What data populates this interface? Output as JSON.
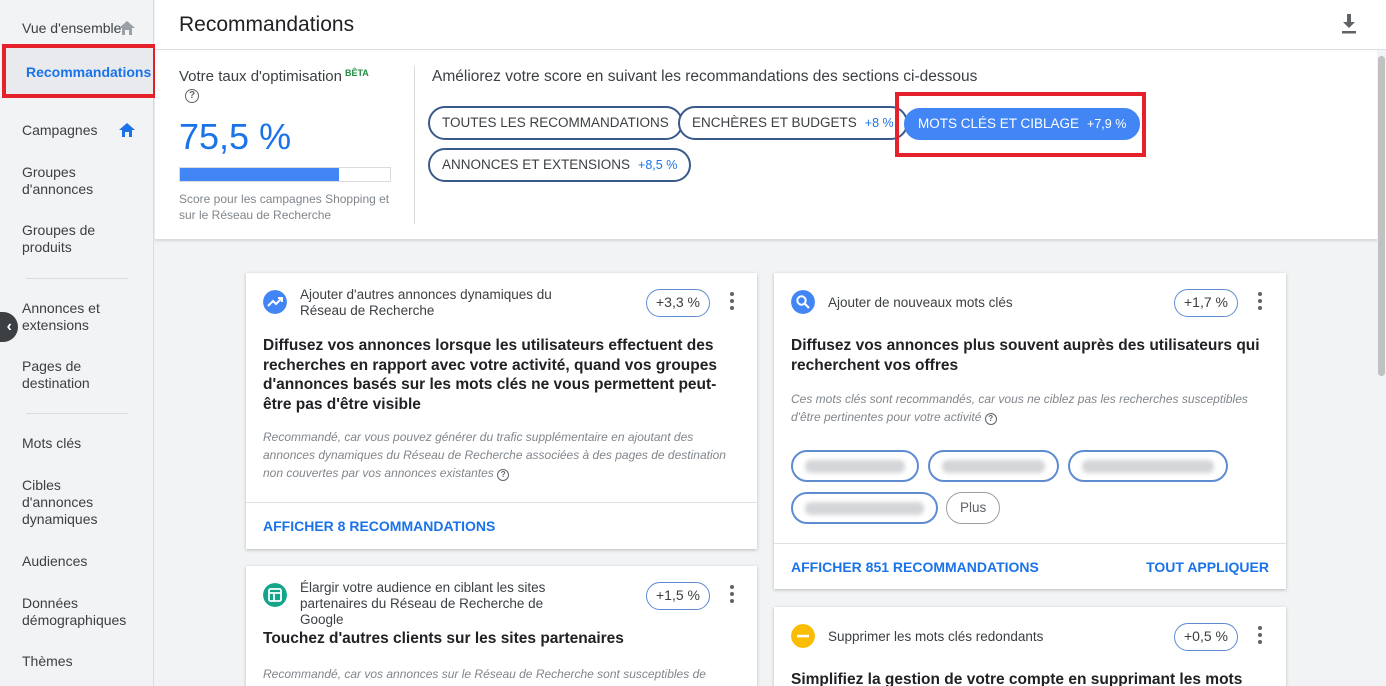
{
  "sidebar": {
    "items": [
      {
        "label": "Vue d'ensemble"
      },
      {
        "label": "Recommandations"
      },
      {
        "label": "Campagnes"
      },
      {
        "label": "Groupes d'annonces"
      },
      {
        "label": "Groupes de produits"
      },
      {
        "label": "Annonces et extensions"
      },
      {
        "label": "Pages de destination"
      },
      {
        "label": "Mots clés"
      },
      {
        "label": "Cibles d'annonces dynamiques"
      },
      {
        "label": "Audiences"
      },
      {
        "label": "Données démographiques"
      },
      {
        "label": "Thèmes"
      }
    ],
    "active": "Recommandations"
  },
  "header": {
    "title": "Recommandations",
    "download_icon": "download-icon"
  },
  "score": {
    "label": "Votre taux d'optimisation",
    "beta": "BÊTA",
    "help": "?",
    "value": "75,5 %",
    "progress_fraction": 0.755,
    "note": "Score pour les campagnes Shopping et sur le Réseau de Recherche"
  },
  "filters": {
    "intro": "Améliorez votre score en suivant les recommandations des sections ci-dessous",
    "chips": [
      {
        "label": "TOUTES LES RECOMMANDATIONS",
        "delta": ""
      },
      {
        "label": "ENCHÈRES ET BUDGETS",
        "delta": "+8 %"
      },
      {
        "label": "MOTS CLÉS ET CIBLAGE",
        "delta": "+7,9 %"
      },
      {
        "label": "ANNONCES ET EXTENSIONS",
        "delta": "+8,5 %"
      }
    ],
    "selected": "MOTS CLÉS ET CIBLAGE"
  },
  "cards": {
    "dynamic_ads": {
      "icon": "trending-up-icon",
      "heading": "Ajouter d'autres annonces dynamiques du Réseau de Recherche",
      "delta": "+3,3 %",
      "title": "Diffusez vos annonces lorsque les utilisateurs effectuent des recherches en rapport avec votre activité, quand vos groupes d'annonces basés sur les mots clés ne vous permettent peut-être pas d'être visible",
      "reason": "Recommandé, car vous pouvez générer du trafic supplémentaire en ajoutant des annonces dynamiques du Réseau de Recherche associées à des pages de destination non couvertes par vos annonces existantes",
      "link": "AFFICHER 8 RECOMMANDATIONS"
    },
    "new_keywords": {
      "icon": "search-icon",
      "heading": "Ajouter de nouveaux mots clés",
      "delta": "+1,7 %",
      "title": "Diffusez vos annonces plus souvent auprès des utilisateurs qui recherchent vos offres",
      "reason": "Ces mots clés sont recommandés, car vous ne ciblez pas les recherches susceptibles d'être pertinentes pour votre activité",
      "more": "Plus",
      "link": "AFFICHER 851 RECOMMANDATIONS",
      "apply": "TOUT APPLIQUER"
    },
    "partners": {
      "icon": "web-partners-icon",
      "heading": "Élargir votre audience en ciblant les sites partenaires du Réseau de Recherche de Google",
      "delta": "+1,5 %",
      "title": "Touchez d'autres clients sur les sites partenaires",
      "reason": "Recommandé, car vos annonces sur le Réseau de Recherche sont susceptibles de"
    },
    "redundant": {
      "icon": "remove-circle-icon",
      "heading": "Supprimer les mots clés redondants",
      "delta": "+0,5 %",
      "title": "Simplifiez la gestion de votre compte en supprimant les mots clés"
    }
  }
}
